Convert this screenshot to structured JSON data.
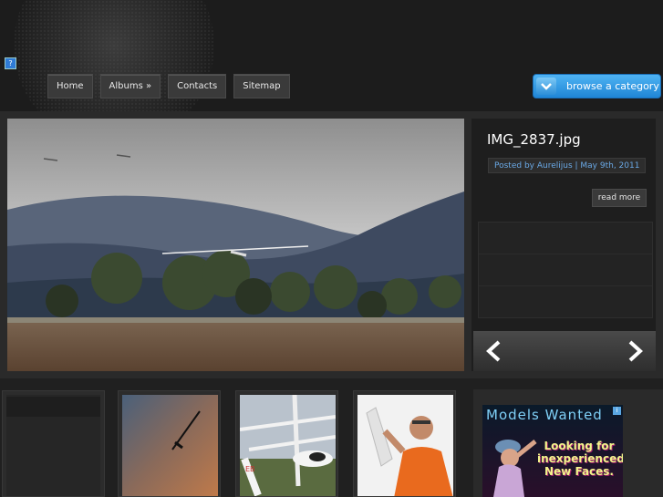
{
  "nav": {
    "items": [
      {
        "label": "Home"
      },
      {
        "label": "Albums »"
      },
      {
        "label": "Contacts"
      },
      {
        "label": "Sitemap"
      }
    ],
    "browse_label": "browse a category"
  },
  "featured": {
    "title": "IMG_2837.jpg",
    "meta": "Posted by Aurelijus | May 9th, 2011",
    "read_more": "read more"
  },
  "slider": {
    "prev_icon": "chevron-left-icon",
    "next_icon": "chevron-right-icon"
  },
  "ad": {
    "title": "Models Wanted",
    "text": "Looking for inexperienced New Faces."
  },
  "colors": {
    "accent": "#2f8fe0",
    "meta_link": "#6aa9e6",
    "ad_title": "#7fd0f7",
    "ad_text": "#f4f48c"
  }
}
